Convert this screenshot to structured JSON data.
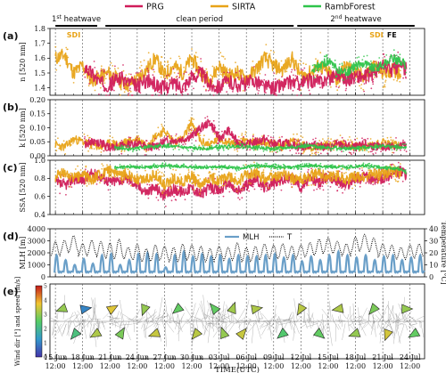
{
  "legend": [
    {
      "name": "PRG",
      "color": "#d01c5a"
    },
    {
      "name": "SIRTA",
      "color": "#e8a317"
    },
    {
      "name": "RambForest",
      "color": "#2ec44a"
    }
  ],
  "periods": [
    {
      "prefix": "1",
      "sup": "st",
      "suffix": " heatwave",
      "from": 0.0,
      "to": 4.6
    },
    {
      "prefix": "clean period",
      "sup": "",
      "suffix": "",
      "from": 5.5,
      "to": 26.2
    },
    {
      "prefix": "2",
      "sup": "nd",
      "suffix": " heatwave",
      "from": 26.6,
      "to": 39.5
    }
  ],
  "events": [
    {
      "text": "SDI",
      "color": "#e8a317",
      "day": 2.0
    },
    {
      "text": "SDI",
      "color": "#e8a317",
      "day": 35.3
    },
    {
      "text": "FE",
      "color": "#111111",
      "day": 37.0
    }
  ],
  "x_axis": {
    "title": "TIME(UTC)",
    "tick_dates": [
      "15 Jun",
      "18 Jun",
      "21 Jun",
      "24 Jun",
      "27 Jun",
      "30 Jun",
      "03 Jul",
      "06 Jul",
      "09 Jul",
      "12 Jul",
      "15 Jul",
      "18 Jul",
      "21 Jul",
      "24 Jul"
    ],
    "tick_time": "12:00",
    "tick_days": [
      0,
      3,
      6,
      9,
      12,
      15,
      18,
      21,
      24,
      27,
      30,
      33,
      36,
      39
    ],
    "minor_days": [
      1,
      2,
      4,
      5,
      7,
      8,
      10,
      11,
      13,
      14,
      16,
      17,
      19,
      20,
      22,
      23,
      25,
      26,
      28,
      29,
      31,
      32,
      34,
      35,
      37,
      38
    ],
    "dashed_days": [
      0,
      3,
      6,
      9,
      12,
      15,
      18,
      21,
      24,
      27,
      30,
      33,
      36,
      39
    ],
    "range": [
      -0.6,
      40.6
    ]
  },
  "panels": [
    {
      "letter": "(a)",
      "ylabel": "n [520 nm]",
      "ylim": [
        1.35,
        1.8
      ],
      "ticks": [
        1.4,
        1.5,
        1.6,
        1.7,
        1.8
      ],
      "tick_labels": [
        "1.4",
        "1.5",
        "1.6",
        "1.7",
        "1.8"
      ]
    },
    {
      "letter": "(b)",
      "ylabel": "k [520 nm]",
      "ylim": [
        0.0,
        0.2
      ],
      "ticks": [
        0.0,
        0.05,
        0.1,
        0.15,
        0.2
      ],
      "tick_labels": [
        "0.00",
        "0.05",
        "0.10",
        "0.15",
        "0.20"
      ]
    },
    {
      "letter": "(c)",
      "ylabel": "SSA [520 nm]",
      "ylim": [
        0.4,
        1.0
      ],
      "ticks": [
        0.4,
        0.6,
        0.8,
        1.0
      ],
      "tick_labels": [
        "0.4",
        "0.6",
        "0.8",
        "1.0"
      ]
    },
    {
      "letter": "(d)",
      "ylabel": "MLH [m]",
      "ylim": [
        0,
        4000
      ],
      "ticks": [
        0,
        1000,
        2000,
        3000,
        4000
      ],
      "tick_labels": [
        "0",
        "1000",
        "2000",
        "3000",
        "4000"
      ],
      "ylabel_right": "Temperature [°C]",
      "ylim_right": [
        0,
        40
      ],
      "ticks_right": [
        0,
        10,
        20,
        30,
        40
      ],
      "tick_labels_right": [
        "0",
        "10",
        "20",
        "30",
        "40"
      ],
      "legend": [
        {
          "name": "MLH",
          "color": "#6a9fc8"
        },
        {
          "name": "T",
          "color": "#111111"
        }
      ]
    },
    {
      "letter": "(e)",
      "ylabel": "Wind dir [°] and speed [m/s]",
      "colorbar": {
        "min": 0,
        "max": 5,
        "ticks": [
          "0",
          "1",
          "2",
          "3",
          "4",
          "5"
        ]
      }
    }
  ],
  "chart_data": {
    "type": "line",
    "note_x": "days after 15 Jun 12:00 UTC",
    "series": [
      {
        "name": "PRG",
        "color": "#d01c5a",
        "n_x": [
          3.2,
          4,
          5,
          6,
          7,
          8,
          9,
          10,
          11,
          12,
          13,
          14,
          15,
          16,
          17,
          18,
          19,
          20,
          21,
          22,
          23,
          24,
          25,
          26,
          27,
          28,
          29,
          30,
          31,
          32,
          33,
          34,
          35,
          36,
          37,
          38,
          38.6
        ],
        "n_y": [
          1.55,
          1.5,
          1.43,
          1.42,
          1.47,
          1.44,
          1.41,
          1.45,
          1.42,
          1.4,
          1.43,
          1.41,
          1.47,
          1.5,
          1.42,
          1.41,
          1.44,
          1.42,
          1.43,
          1.45,
          1.41,
          1.4,
          1.42,
          1.44,
          1.43,
          1.45,
          1.44,
          1.46,
          1.5,
          1.46,
          1.48,
          1.47,
          1.5,
          1.55,
          1.52,
          1.55,
          1.52
        ],
        "k_x": [
          3.2,
          4,
          5,
          6,
          7,
          8,
          9,
          10,
          11,
          12,
          13,
          14,
          15,
          16,
          17,
          18,
          19,
          20,
          21,
          22,
          23,
          24,
          25,
          26,
          27,
          28,
          29,
          30,
          31,
          32,
          33,
          34,
          35,
          36,
          37,
          38,
          38.6
        ],
        "k_y": [
          0.04,
          0.05,
          0.045,
          0.03,
          0.035,
          0.04,
          0.045,
          0.03,
          0.035,
          0.05,
          0.055,
          0.06,
          0.07,
          0.1,
          0.12,
          0.06,
          0.09,
          0.05,
          0.04,
          0.05,
          0.06,
          0.04,
          0.045,
          0.04,
          0.03,
          0.04,
          0.035,
          0.03,
          0.04,
          0.035,
          0.03,
          0.04,
          0.035,
          0.03,
          0.035,
          0.04,
          0.035
        ],
        "ssa_x": [
          0,
          1,
          2,
          3,
          4,
          5,
          6,
          7,
          8,
          9,
          10,
          11,
          12,
          13,
          14,
          15,
          16,
          17,
          18,
          19,
          20,
          21,
          22,
          23,
          24,
          25,
          26,
          27,
          28,
          29,
          30,
          31,
          32,
          33,
          34,
          35,
          36,
          37,
          38,
          38.6
        ],
        "ssa_y": [
          0.75,
          0.72,
          0.8,
          0.78,
          0.85,
          0.82,
          0.76,
          0.78,
          0.8,
          0.72,
          0.65,
          0.7,
          0.6,
          0.68,
          0.65,
          0.7,
          0.62,
          0.7,
          0.66,
          0.75,
          0.65,
          0.72,
          0.8,
          0.7,
          0.76,
          0.78,
          0.82,
          0.7,
          0.8,
          0.75,
          0.82,
          0.78,
          0.72,
          0.8,
          0.82,
          0.78,
          0.8,
          0.85,
          0.88,
          0.82
        ]
      },
      {
        "name": "SIRTA",
        "color": "#e8a317",
        "n_x": [
          0,
          1,
          2,
          3,
          4,
          5,
          6,
          7,
          8,
          9,
          10,
          11,
          12,
          13,
          14,
          15,
          16,
          17,
          18,
          19,
          20,
          21,
          22,
          23,
          24,
          25,
          26,
          27,
          28,
          29,
          30,
          31,
          32,
          33,
          34,
          35,
          36,
          37,
          38
        ],
        "n_y": [
          1.6,
          1.62,
          1.5,
          1.55,
          1.45,
          1.48,
          1.5,
          1.45,
          1.42,
          1.46,
          1.52,
          1.6,
          1.48,
          1.55,
          1.5,
          1.6,
          1.5,
          1.45,
          1.55,
          1.48,
          1.5,
          1.46,
          1.52,
          1.6,
          1.55,
          1.52,
          1.6,
          1.48,
          1.5,
          1.55,
          1.5,
          1.45,
          1.55,
          1.5,
          1.48,
          1.55,
          1.5,
          1.52,
          1.5
        ],
        "k_x": [
          0,
          1,
          2,
          3,
          4,
          5,
          6,
          7,
          8,
          9,
          10,
          11,
          12,
          13,
          14,
          15,
          16,
          17,
          18,
          19,
          20,
          21,
          22,
          23,
          24,
          25,
          26,
          27,
          28,
          29,
          30,
          31,
          32,
          33,
          34,
          35,
          36,
          37,
          38
        ],
        "k_y": [
          0.04,
          0.03,
          0.06,
          0.05,
          0.04,
          0.03,
          0.045,
          0.04,
          0.05,
          0.06,
          0.04,
          0.07,
          0.09,
          0.05,
          0.06,
          0.12,
          0.05,
          0.04,
          0.06,
          0.05,
          0.04,
          0.06,
          0.045,
          0.05,
          0.04,
          0.035,
          0.06,
          0.04,
          0.03,
          0.035,
          0.04,
          0.045,
          0.04,
          0.035,
          0.03,
          0.04,
          0.05,
          0.04,
          0.035
        ],
        "ssa_x": [
          0,
          1,
          2,
          3,
          4,
          5,
          6,
          7,
          8,
          9,
          10,
          11,
          12,
          13,
          14,
          15,
          16,
          17,
          18,
          19,
          20,
          21,
          22,
          23,
          24,
          25,
          26,
          27,
          28,
          29,
          30,
          31,
          32,
          33,
          34,
          35,
          36,
          37,
          38
        ],
        "ssa_y": [
          0.82,
          0.86,
          0.8,
          0.84,
          0.78,
          0.85,
          0.88,
          0.82,
          0.85,
          0.78,
          0.8,
          0.84,
          0.72,
          0.8,
          0.76,
          0.82,
          0.7,
          0.8,
          0.78,
          0.82,
          0.75,
          0.84,
          0.86,
          0.8,
          0.82,
          0.85,
          0.8,
          0.78,
          0.82,
          0.86,
          0.8,
          0.84,
          0.78,
          0.82,
          0.8,
          0.86,
          0.84,
          0.88,
          0.86
        ]
      },
      {
        "name": "RambForest",
        "color": "#2ec44a",
        "n_x": [
          28.2,
          29,
          30,
          31,
          32,
          33,
          34,
          35,
          36,
          37,
          38,
          38.6
        ],
        "n_y": [
          1.5,
          1.55,
          1.58,
          1.52,
          1.5,
          1.55,
          1.57,
          1.53,
          1.55,
          1.6,
          1.58,
          1.55
        ],
        "k_x": [
          6.5,
          8,
          10,
          12,
          14,
          16,
          18,
          20,
          22,
          24,
          26,
          28,
          30,
          32,
          34,
          36,
          38,
          38.6
        ],
        "k_y": [
          0.03,
          0.025,
          0.03,
          0.035,
          0.03,
          0.025,
          0.03,
          0.035,
          0.03,
          0.025,
          0.03,
          0.035,
          0.03,
          0.025,
          0.03,
          0.035,
          0.03,
          0.03
        ],
        "ssa_x": [
          6.5,
          8,
          10,
          12,
          14,
          16,
          18,
          20,
          22,
          24,
          26,
          28,
          30,
          32,
          34,
          36,
          38,
          38.6
        ],
        "ssa_y": [
          0.92,
          0.93,
          0.92,
          0.94,
          0.93,
          0.92,
          0.93,
          0.91,
          0.94,
          0.93,
          0.92,
          0.94,
          0.93,
          0.92,
          0.94,
          0.92,
          0.9,
          0.86
        ]
      }
    ],
    "mlh": {
      "name": "MLH",
      "color": "#6a9fc8",
      "daily_peaks_m": [
        1800,
        1400,
        1000,
        1500,
        1100,
        1800,
        1900,
        1000,
        1400,
        1900,
        2000,
        1900,
        800,
        1800,
        2100,
        1700,
        1900,
        1700,
        1800,
        1500,
        1800,
        1700,
        1700,
        1800,
        1900,
        1600,
        1800,
        1300,
        1700,
        1400,
        1800,
        2100,
        1800,
        1600,
        1800,
        1400,
        1700,
        1800,
        1400,
        1600,
        1800
      ],
      "night_m": 350
    },
    "temperature": {
      "name": "T",
      "color": "#111111",
      "daily_max_c": [
        30,
        31,
        35,
        28,
        31,
        30,
        29,
        32,
        25,
        28,
        24,
        27,
        26,
        25,
        28,
        27,
        26,
        24,
        26,
        25,
        29,
        25,
        26,
        28,
        27,
        28,
        26,
        27,
        29,
        32,
        33,
        30,
        28,
        34,
        36,
        33,
        28,
        27,
        25,
        27,
        28
      ],
      "daily_min_c": [
        17,
        19,
        21,
        17,
        18,
        16,
        14,
        15,
        14,
        13,
        12,
        13,
        14,
        12,
        13,
        14,
        13,
        12,
        14,
        13,
        14,
        12,
        13,
        15,
        14,
        15,
        14,
        16,
        17,
        18,
        20,
        19,
        17,
        20,
        22,
        20,
        16,
        15,
        14,
        15,
        16
      ]
    },
    "wind": {
      "colorbar_range": [
        0,
        5
      ],
      "arrows": [
        {
          "day": 0.8,
          "dir_deg": 250,
          "speed": 3.0
        },
        {
          "day": 2.2,
          "dir_deg": 220,
          "speed": 2.2
        },
        {
          "day": 3.2,
          "dir_deg": 80,
          "speed": 1.0
        },
        {
          "day": 4.5,
          "dir_deg": 240,
          "speed": 3.2
        },
        {
          "day": 6.2,
          "dir_deg": 60,
          "speed": 3.6
        },
        {
          "day": 7.2,
          "dir_deg": 30,
          "speed": 2.8
        },
        {
          "day": 9.8,
          "dir_deg": 200,
          "speed": 3.0
        },
        {
          "day": 11.0,
          "dir_deg": 250,
          "speed": 3.4
        },
        {
          "day": 13.5,
          "dir_deg": 230,
          "speed": 2.6
        },
        {
          "day": 15.5,
          "dir_deg": 220,
          "speed": 3.3
        },
        {
          "day": 17.5,
          "dir_deg": 320,
          "speed": 2.6
        },
        {
          "day": 18.5,
          "dir_deg": 340,
          "speed": 3.0
        },
        {
          "day": 19.5,
          "dir_deg": 20,
          "speed": 3.1
        },
        {
          "day": 20.5,
          "dir_deg": 40,
          "speed": 3.4
        },
        {
          "day": 22.0,
          "dir_deg": 80,
          "speed": 3.2
        },
        {
          "day": 25.0,
          "dir_deg": 230,
          "speed": 2.4
        },
        {
          "day": 27.0,
          "dir_deg": 210,
          "speed": 3.3
        },
        {
          "day": 29.0,
          "dir_deg": 130,
          "speed": 2.6
        },
        {
          "day": 31.2,
          "dir_deg": 260,
          "speed": 3.2
        },
        {
          "day": 33.0,
          "dir_deg": 250,
          "speed": 3.0
        },
        {
          "day": 35.0,
          "dir_deg": 220,
          "speed": 2.8
        },
        {
          "day": 36.5,
          "dir_deg": 200,
          "speed": 3.5
        },
        {
          "day": 38.5,
          "dir_deg": 90,
          "speed": 3.0
        },
        {
          "day": 39.5,
          "dir_deg": 240,
          "speed": 2.6
        }
      ]
    }
  }
}
